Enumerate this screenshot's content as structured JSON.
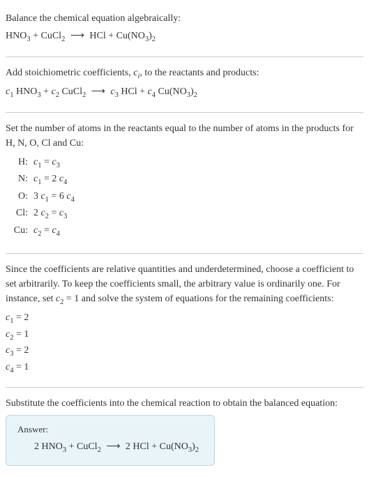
{
  "intro": {
    "line1": "Balance the chemical equation algebraically:",
    "eq_lhs1": "HNO",
    "eq_lhs1_sub": "3",
    "eq_plus1": " + CuCl",
    "eq_lhs2_sub": "2",
    "eq_arrow": " ⟶ ",
    "eq_rhs1": "HCl + Cu(NO",
    "eq_rhs1_sub": "3",
    "eq_rhs1_close": ")",
    "eq_rhs1_sub2": "2"
  },
  "stoich": {
    "text": "Add stoichiometric coefficients, ",
    "ci": "c",
    "ci_sub": "i",
    "text2": ", to the reactants and products:",
    "c1": "c",
    "c1_sub": "1",
    "sp1": " HNO",
    "sp1_sub": "3",
    "plus1": " + ",
    "c2": "c",
    "c2_sub": "2",
    "sp2": " CuCl",
    "sp2_sub": "2",
    "arrow": " ⟶ ",
    "c3": "c",
    "c3_sub": "3",
    "sp3": " HCl + ",
    "c4": "c",
    "c4_sub": "4",
    "sp4": " Cu(NO",
    "sp4_sub": "3",
    "sp4_close": ")",
    "sp4_sub2": "2"
  },
  "atoms": {
    "intro": "Set the number of atoms in the reactants equal to the number of atoms in the products for H, N, O, Cl and Cu:",
    "rows": [
      {
        "label": "H:",
        "c_a": "c",
        "a_sub": "1",
        "eq": " = ",
        "c_b": "c",
        "b_sub": "3",
        "pre_a": "",
        "pre_b": ""
      },
      {
        "label": "N:",
        "c_a": "c",
        "a_sub": "1",
        "eq": " = 2 ",
        "c_b": "c",
        "b_sub": "4",
        "pre_a": "",
        "pre_b": ""
      },
      {
        "label": "O:",
        "c_a": "c",
        "a_sub": "1",
        "eq": " = 6 ",
        "c_b": "c",
        "b_sub": "4",
        "pre_a": "3 ",
        "pre_b": ""
      },
      {
        "label": "Cl:",
        "c_a": "c",
        "a_sub": "2",
        "eq": " = ",
        "c_b": "c",
        "b_sub": "3",
        "pre_a": "2 ",
        "pre_b": ""
      },
      {
        "label": "Cu:",
        "c_a": "c",
        "a_sub": "2",
        "eq": " = ",
        "c_b": "c",
        "b_sub": "4",
        "pre_a": "",
        "pre_b": ""
      }
    ]
  },
  "arbitrary": {
    "text1": "Since the coefficients are relative quantities and underdetermined, choose a coefficient to set arbitrarily. To keep the coefficients small, the arbitrary value is ordinarily one. For instance, set ",
    "c2": "c",
    "c2_sub": "2",
    "text2": " = 1 and solve the system of equations for the remaining coefficients:",
    "lines": [
      {
        "c": "c",
        "sub": "1",
        "val": " = 2"
      },
      {
        "c": "c",
        "sub": "2",
        "val": " = 1"
      },
      {
        "c": "c",
        "sub": "3",
        "val": " = 2"
      },
      {
        "c": "c",
        "sub": "4",
        "val": " = 1"
      }
    ]
  },
  "substitute": {
    "text": "Substitute the coefficients into the chemical reaction to obtain the balanced equation:"
  },
  "answer": {
    "label": "Answer:",
    "pre1": "2 HNO",
    "sub1": "3",
    "plus": " + CuCl",
    "sub2": "2",
    "arrow": " ⟶ ",
    "post1": "2 HCl + Cu(NO",
    "sub3": "3",
    "close": ")",
    "sub4": "2"
  }
}
